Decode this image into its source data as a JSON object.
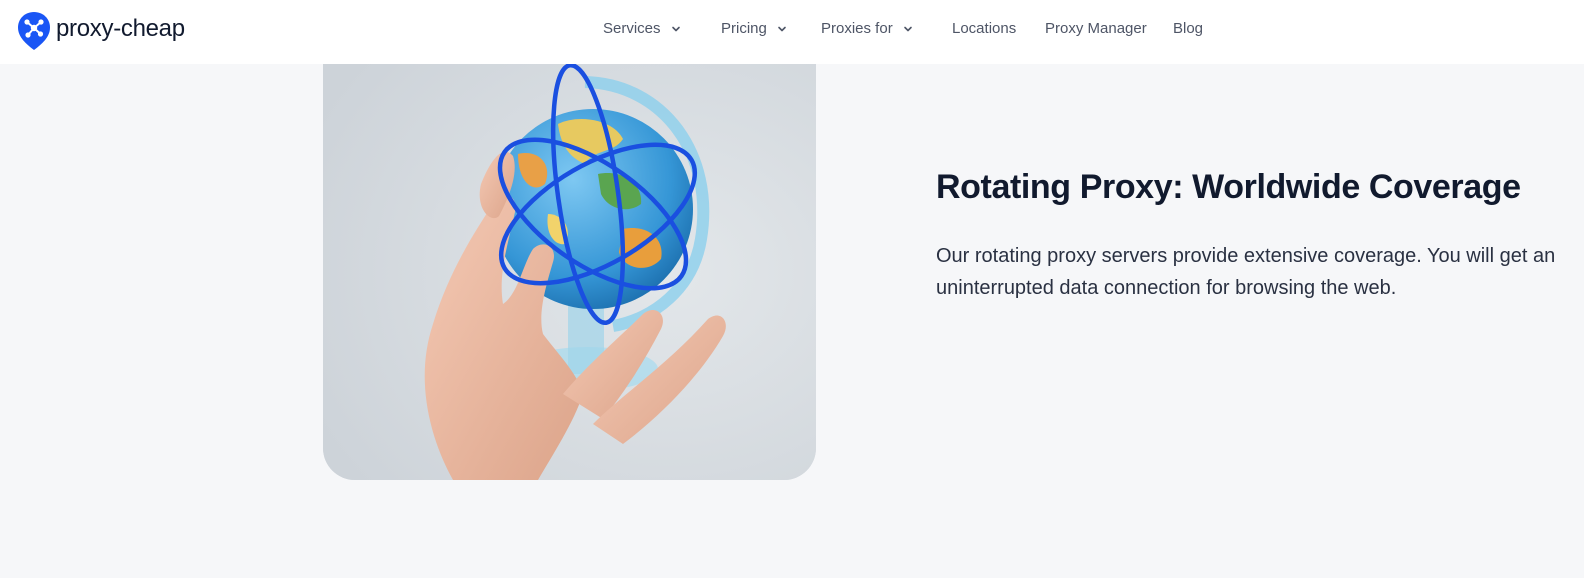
{
  "brand": {
    "name": "proxy-cheap",
    "accent_color": "#1a56f5",
    "logo_icon": "proxy-cheap-logo-pin-icon"
  },
  "nav": {
    "items": [
      {
        "label": "Services",
        "has_dropdown": true
      },
      {
        "label": "Pricing",
        "has_dropdown": true
      },
      {
        "label": "Proxies for",
        "has_dropdown": true
      },
      {
        "label": "Locations",
        "has_dropdown": false
      },
      {
        "label": "Proxy Manager",
        "has_dropdown": false
      },
      {
        "label": "Blog",
        "has_dropdown": false
      }
    ],
    "dropdown_icon": "chevron-down-icon"
  },
  "feature": {
    "image_subject": "hand holding globe with orbit rings",
    "headline": "Rotating Proxy: Worldwide Coverage",
    "description": "Our rotating proxy servers provide extensive coverage. You will get an uninterrupted data connection for browsing the web."
  }
}
